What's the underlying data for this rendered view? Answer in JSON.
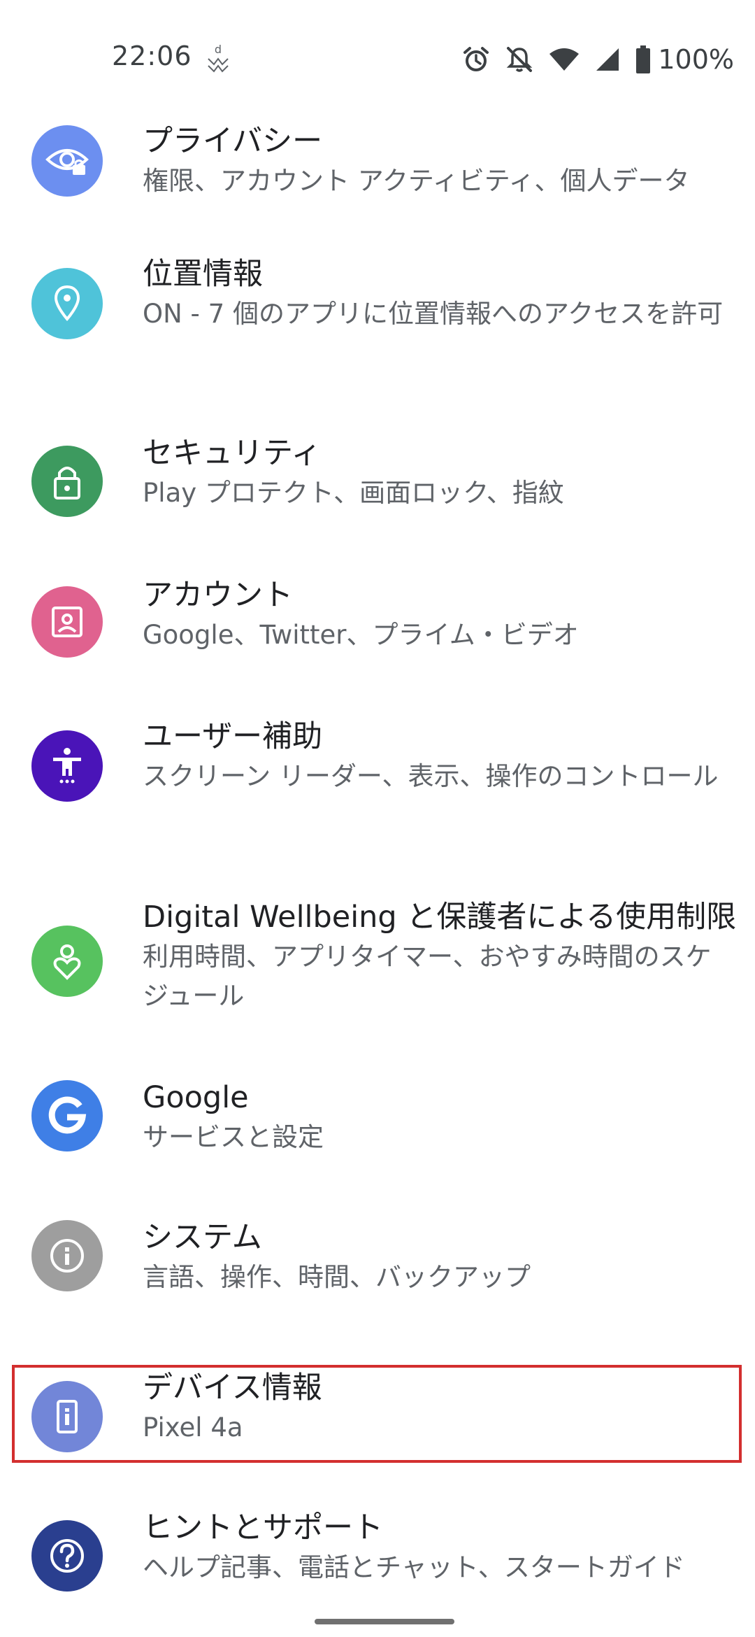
{
  "status_bar": {
    "time": "22:06",
    "battery": "100%",
    "icons": [
      "notification-icon",
      "alarm-icon",
      "silent-icon",
      "wifi-icon",
      "signal-icon",
      "battery-icon"
    ]
  },
  "settings": {
    "items": [
      {
        "title": "プライバシー",
        "summary": "権限、アカウント アクティビティ、個人データ",
        "icon": "privacy-eye-icon",
        "color": "#6c8ff0"
      },
      {
        "title": "位置情報",
        "summary": "ON - 7 個のアプリに位置情報へのアクセスを許可",
        "icon": "location-pin-icon",
        "color": "#4fc3d9"
      },
      {
        "title": "セキュリティ",
        "summary": "Play プロテクト、画面ロック、指紋",
        "icon": "lock-icon",
        "color": "#3d9a5f"
      },
      {
        "title": "アカウント",
        "summary": "Google、Twitter、プライム・ビデオ",
        "icon": "account-box-icon",
        "color": "#e0628f"
      },
      {
        "title": "ユーザー補助",
        "summary": "スクリーン リーダー、表示、操作のコントロール",
        "icon": "accessibility-icon",
        "color": "#4a14b8"
      },
      {
        "title": "Digital Wellbeing と保護者による使用制限",
        "summary": "利用時間、アプリタイマー、おやすみ時間のスケジュール",
        "icon": "wellbeing-icon",
        "color": "#57c25f"
      },
      {
        "title": "Google",
        "summary": "サービスと設定",
        "icon": "google-g-icon",
        "color": "#3f7fe6"
      },
      {
        "title": "システム",
        "summary": "言語、操作、時間、バックアップ",
        "icon": "info-icon",
        "color": "#9e9e9e"
      },
      {
        "title": "デバイス情報",
        "summary": "Pixel 4a",
        "icon": "phone-icon",
        "color": "#7286d8"
      },
      {
        "title": "ヒントとサポート",
        "summary": "ヘルプ記事、電話とチャット、スタートガイド",
        "icon": "help-icon",
        "color": "#2a3f8f"
      }
    ]
  },
  "colors": {
    "highlight": "#d32f2f"
  }
}
